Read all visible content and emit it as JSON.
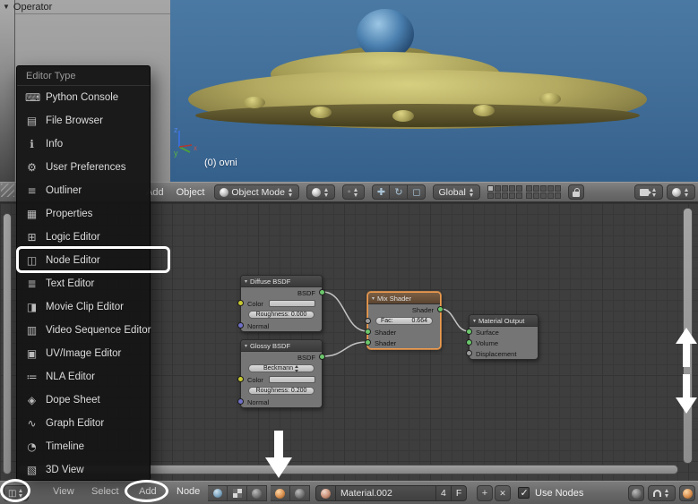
{
  "toolshelf": {
    "operator_label": "Operator"
  },
  "editor_menu": {
    "title": "Editor Type",
    "items": [
      {
        "label": "Python Console",
        "glyph": "⌨"
      },
      {
        "label": "File Browser",
        "glyph": "▤"
      },
      {
        "label": "Info",
        "glyph": "ℹ"
      },
      {
        "label": "User Preferences",
        "glyph": "⚙"
      },
      {
        "label": "Outliner",
        "glyph": "≡"
      },
      {
        "label": "Properties",
        "glyph": "▦"
      },
      {
        "label": "Logic Editor",
        "glyph": "⊞"
      },
      {
        "label": "Node Editor",
        "glyph": "◫"
      },
      {
        "label": "Text Editor",
        "glyph": "≣"
      },
      {
        "label": "Movie Clip Editor",
        "glyph": "◨"
      },
      {
        "label": "Video Sequence Editor",
        "glyph": "▥"
      },
      {
        "label": "UV/Image Editor",
        "glyph": "▣"
      },
      {
        "label": "NLA Editor",
        "glyph": "≔"
      },
      {
        "label": "Dope Sheet",
        "glyph": "◈"
      },
      {
        "label": "Graph Editor",
        "glyph": "∿"
      },
      {
        "label": "Timeline",
        "glyph": "◔"
      },
      {
        "label": "3D View",
        "glyph": "▧"
      }
    ]
  },
  "viewport": {
    "label": "(0) ovni",
    "axis_z": "z",
    "axis_y": "y",
    "axis_x": "x"
  },
  "view3d_header": {
    "menus": [
      "Add",
      "Object"
    ],
    "mode": "Object Mode",
    "orientation": "Global"
  },
  "node_graph": {
    "diffuse": {
      "title": "Diffuse BSDF",
      "out": "BSDF",
      "color": "Color",
      "roughness": "Roughness: 0.000",
      "normal": "Normal"
    },
    "glossy": {
      "title": "Glossy BSDF",
      "out": "BSDF",
      "distribution": "Beckmann",
      "color": "Color",
      "roughness": "Roughness: 0.200",
      "normal": "Normal"
    },
    "mix": {
      "title": "Mix Shader",
      "out": "Shader",
      "fac_label": "Fac:",
      "fac_value": "0.664",
      "in1": "Shader",
      "in2": "Shader"
    },
    "output": {
      "title": "Material Output",
      "surface": "Surface",
      "volume": "Volume",
      "displacement": "Displacement"
    }
  },
  "node_header": {
    "menus": {
      "view": "View",
      "select": "Select",
      "add": "Add",
      "node": "Node"
    },
    "material_name": "Material.002",
    "users": "4",
    "fake_user": "F",
    "use_nodes": "Use Nodes"
  },
  "icons": {
    "plus": "+",
    "close": "✕"
  }
}
